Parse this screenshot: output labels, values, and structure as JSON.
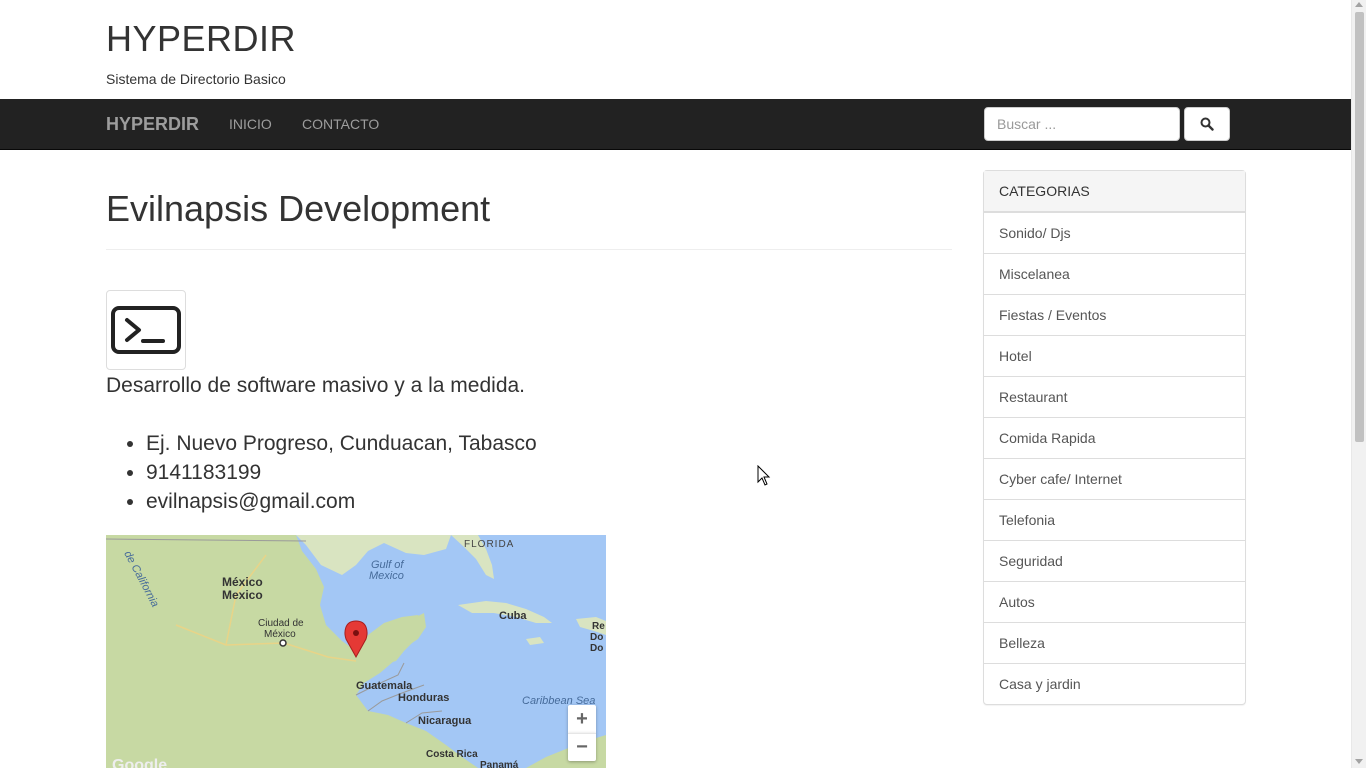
{
  "header": {
    "title": "HYPERDIR",
    "subtitle": "Sistema de Directorio Basico"
  },
  "navbar": {
    "brand": "HYPERDIR",
    "links": [
      "INICIO",
      "CONTACTO"
    ],
    "search_placeholder": "Buscar ...",
    "search_icon": "search-icon"
  },
  "listing": {
    "name": "Evilnapsis Development",
    "logo_icon": "terminal-icon",
    "description": "Desarrollo de software masivo y a la medida.",
    "address": "Ej. Nuevo Progreso, Cunduacan, Tabasco",
    "phone": "9141183199",
    "email": "evilnapsis@gmail.com"
  },
  "map": {
    "labels": [
      "Gulf of",
      "Mexico",
      "FLORIDA",
      "México",
      "Mexico",
      "Ciudad de",
      "México",
      "Cuba",
      "Guatemala",
      "Honduras",
      "Nicaragua",
      "Caribbean Sea",
      "Costa Rica",
      "Panamá",
      "de California",
      "Re",
      "Do",
      "Do",
      "Google"
    ],
    "zoom_in": "+",
    "zoom_out": "−",
    "marker_icon": "map-pin-icon"
  },
  "sidebar": {
    "heading": "CATEGORIAS",
    "items": [
      "Sonido/ Djs",
      "Miscelanea",
      "Fiestas / Eventos",
      "Hotel",
      "Restaurant",
      "Comida Rapida",
      "Cyber cafe/ Internet",
      "Telefonia",
      "Seguridad",
      "Autos",
      "Belleza",
      "Casa y jardin"
    ]
  }
}
